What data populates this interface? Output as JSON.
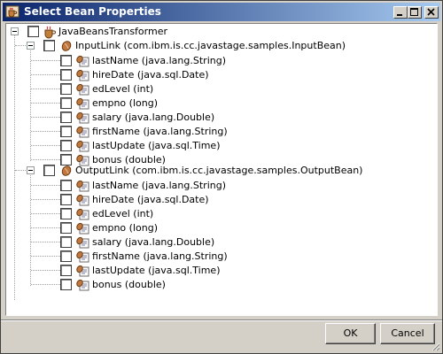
{
  "window": {
    "title": "Select Bean Properties"
  },
  "tree": {
    "root": {
      "label": "JavaBeansTransformer"
    },
    "groups": [
      {
        "label": "InputLink (com.ibm.is.cc.javastage.samples.InputBean)",
        "items": [
          "lastName (java.lang.String)",
          "hireDate (java.sql.Date)",
          "edLevel (int)",
          "empno (long)",
          "salary (java.lang.Double)",
          "firstName (java.lang.String)",
          "lastUpdate (java.sql.Time)",
          "bonus (double)"
        ]
      },
      {
        "label": "OutputLink (com.ibm.is.cc.javastage.samples.OutputBean)",
        "items": [
          "lastName (java.lang.String)",
          "hireDate (java.sql.Date)",
          "edLevel (int)",
          "empno (long)",
          "salary (java.lang.Double)",
          "firstName (java.lang.String)",
          "lastUpdate (java.sql.Time)",
          "bonus (double)"
        ]
      }
    ]
  },
  "buttons": {
    "ok": "OK",
    "cancel": "Cancel"
  },
  "icons": {
    "app": "java-cup-icon",
    "group": "bean-icon",
    "property": "property-icon"
  }
}
